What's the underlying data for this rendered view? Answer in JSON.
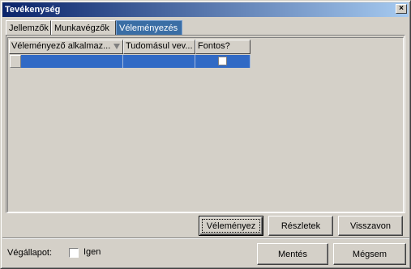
{
  "window": {
    "title": "Tevékenység",
    "close_glyph": "×"
  },
  "tabs": [
    {
      "label": "Jellemzők",
      "active": false
    },
    {
      "label": "Munkavégzők",
      "active": false
    },
    {
      "label": "Véleményezés",
      "active": true
    }
  ],
  "grid": {
    "columns": [
      {
        "header": "Véleményező alkalmaz..."
      },
      {
        "header": "Tudomásul vev..."
      },
      {
        "header": "Fontos?"
      }
    ],
    "rows": [
      {
        "reviewer": "",
        "acknowledged": "",
        "important": false
      }
    ]
  },
  "actions": {
    "review_label": "Véleményez",
    "details_label": "Részletek",
    "revoke_label": "Visszavon"
  },
  "footer": {
    "final_state_label": "Végállapot:",
    "final_state_checkbox_label": "Igen",
    "final_state_checked": false,
    "save_label": "Mentés",
    "cancel_label": "Mégsem"
  },
  "colors": {
    "title_gradient_start": "#0a246a",
    "title_gradient_end": "#a6caf0",
    "selection": "#316ac5",
    "active_tab": "#3a6ea5",
    "face": "#d4d0c8"
  }
}
